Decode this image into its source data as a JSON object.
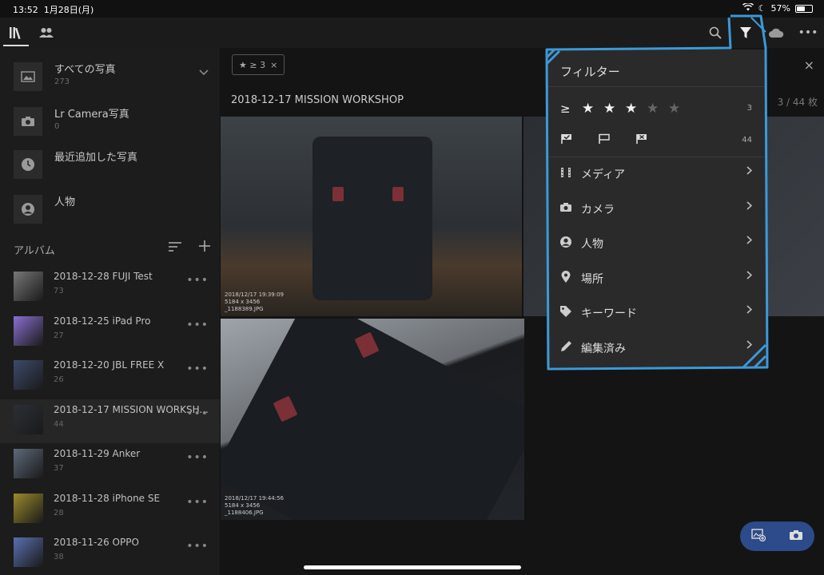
{
  "status_bar": {
    "time": "13:52",
    "date": "1月28日(月)",
    "battery": "57%",
    "battery_level": 0.57
  },
  "top_bar": {
    "icons": [
      "library-icon",
      "people-icon",
      "search-icon",
      "filter-icon",
      "cloud-icon",
      "more-icon"
    ]
  },
  "library": [
    {
      "name": "すべての写真",
      "count": "273"
    },
    {
      "name": "Lr Camera写真",
      "count": "0"
    },
    {
      "name": "最近追加した写真",
      "count": ""
    },
    {
      "name": "人物",
      "count": ""
    }
  ],
  "albums_header": "アルバム",
  "albums": [
    {
      "name": "2018-12-28 FUJI Test",
      "count": "73",
      "color": "#777"
    },
    {
      "name": "2018-12-25 iPad Pro",
      "count": "27",
      "color": "#8a6fd0"
    },
    {
      "name": "2018-12-20 JBL FREE X",
      "count": "26",
      "color": "#3c4a6a"
    },
    {
      "name": "2018-12-17 MISSION WORKSH...",
      "count": "44",
      "color": "#2b2f35"
    },
    {
      "name": "2018-11-29 Anker",
      "count": "37",
      "color": "#5d6a7a"
    },
    {
      "name": "2018-11-28 iPhone SE",
      "count": "28",
      "color": "#9c8a2a"
    },
    {
      "name": "2018-11-26 OPPO",
      "count": "38",
      "color": "#5a6fb0"
    }
  ],
  "main": {
    "filter_chip": "★ ≥ 3",
    "filter_chip_close": "×",
    "close": "×",
    "folder_title": "2018-12-17 MISSION WORKSHOP",
    "page_count": "3 / 44 枚",
    "photos": [
      {
        "datetime": "2018/12/17 19:39:09",
        "dims": "5184 x 3456",
        "file": "_1188389.JPG"
      },
      {
        "datetime": "2018/12/17 19:44:56",
        "dims": "5184 x 3456",
        "file": "_1188406.JPG"
      }
    ]
  },
  "filter_panel": {
    "title": "フィルター",
    "rating_operator": "≥",
    "rating_value": 3,
    "rating_max": 5,
    "rating_count": "3",
    "flag_count": "44",
    "items": [
      {
        "icon": "film-icon",
        "label": "メディア"
      },
      {
        "icon": "camera-icon",
        "label": "カメラ"
      },
      {
        "icon": "person-icon",
        "label": "人物"
      },
      {
        "icon": "location-pin-icon",
        "label": "場所"
      },
      {
        "icon": "tag-icon",
        "label": "キーワード"
      },
      {
        "icon": "pencil-icon",
        "label": "編集済み"
      }
    ]
  },
  "colors": {
    "annotation": "#3b9ad9",
    "fab": "#2d4a8a"
  }
}
